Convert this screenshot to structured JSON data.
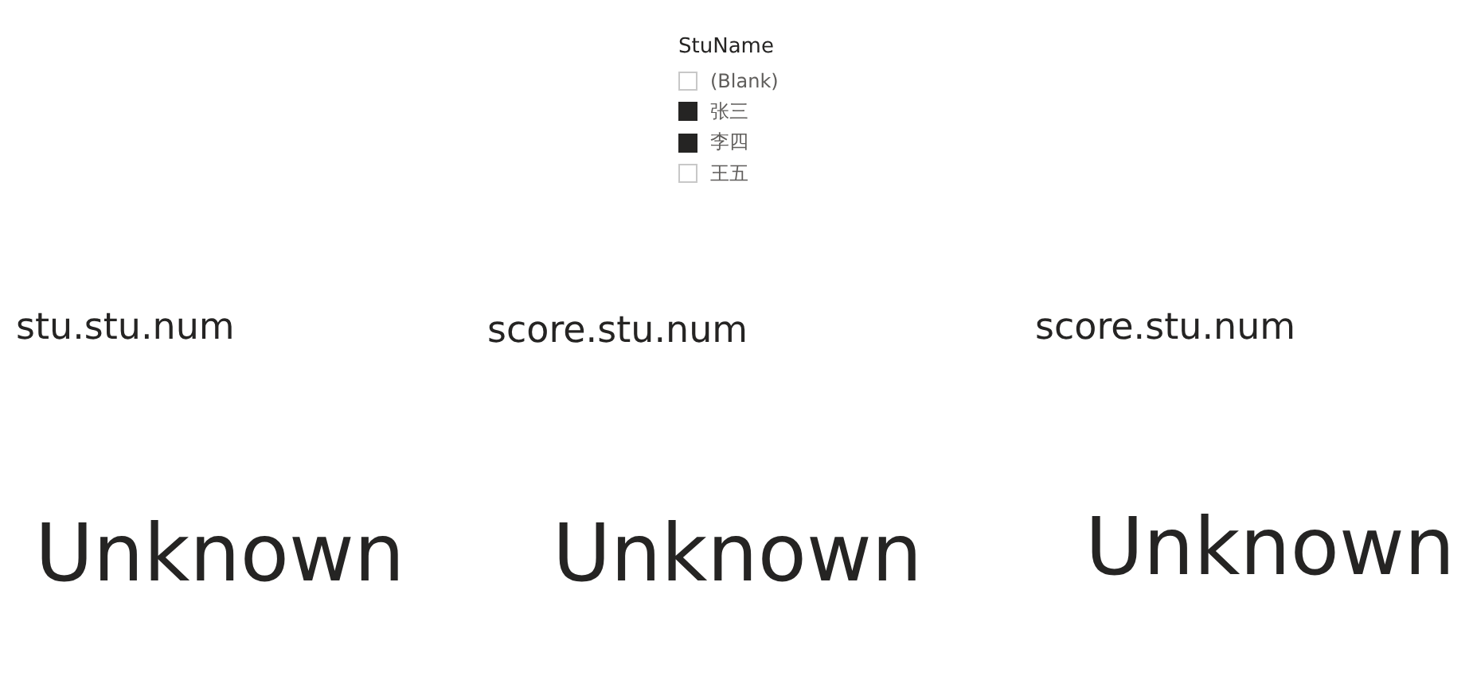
{
  "slicer": {
    "title": "StuName",
    "items": [
      {
        "label": "(Blank)",
        "checked": false
      },
      {
        "label": "张三",
        "checked": true
      },
      {
        "label": "李四",
        "checked": true
      },
      {
        "label": "王五",
        "checked": false
      }
    ]
  },
  "cards": [
    {
      "label": "stu.stu.num",
      "value": "Unknown"
    },
    {
      "label": "score.stu.num",
      "value": "Unknown"
    },
    {
      "label": "score.stu.num",
      "value": "Unknown"
    }
  ]
}
